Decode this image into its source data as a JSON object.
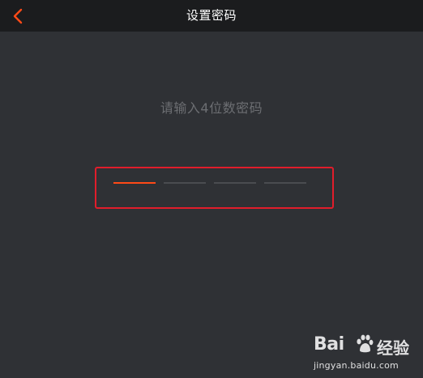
{
  "header": {
    "title": "设置密码",
    "back_icon": "chevron-left-icon",
    "accent_color": "#ff4a17"
  },
  "pin": {
    "prompt": "请输入4位数密码",
    "length": 4,
    "filled": 0,
    "active_index": 0
  },
  "watermark": {
    "logo_text": "Bai",
    "logo_icon": "paw-icon",
    "label": "经验",
    "domain": "jingyan.baidu.com"
  },
  "colors": {
    "background": "#2f3135",
    "header_background": "#1b1c1e",
    "slot_inactive": "#4a4c50",
    "slot_active": "#ff4a17",
    "highlight_box": "#e11d2b"
  }
}
